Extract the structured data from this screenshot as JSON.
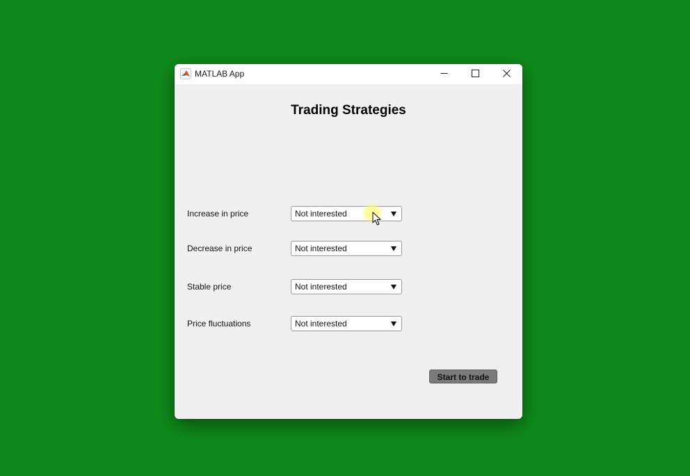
{
  "window": {
    "title": "MATLAB App",
    "icon": "matlab-logo-icon",
    "controls": [
      "minimize-icon",
      "maximize-icon",
      "close-icon"
    ]
  },
  "app": {
    "heading": "Trading Strategies",
    "rows": [
      {
        "label": "Increase in price",
        "selected": "Not interested"
      },
      {
        "label": "Decrease in price",
        "selected": "Not interested"
      },
      {
        "label": "Stable price",
        "selected": "Not interested"
      },
      {
        "label": "Price fluctuations",
        "selected": "Not interested"
      }
    ],
    "start_button": "Start to trade"
  },
  "colors": {
    "desktop_background": "#0f8a1a",
    "window_background": "#f0f0f0",
    "button_background": "#7a7a7a"
  }
}
